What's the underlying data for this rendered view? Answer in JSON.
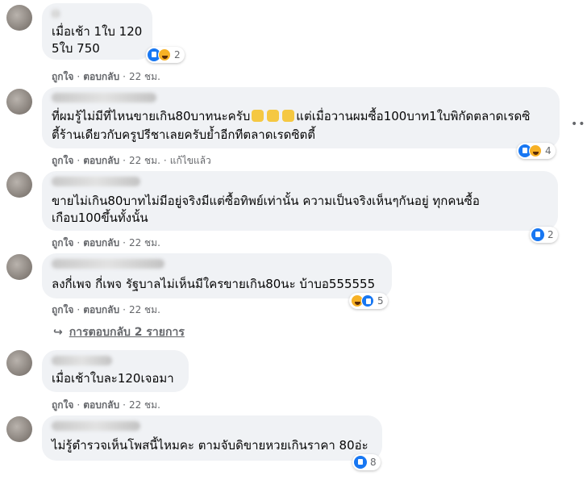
{
  "actions": {
    "like": "ถูกใจ",
    "reply": "ตอบกลับ",
    "separator": "·",
    "edited": "แก้ไขแล้ว"
  },
  "comments": [
    {
      "lines": [
        "เมื่อเช้า 1ใบ 120",
        "5ใบ 750"
      ],
      "time": "22 ชม.",
      "reaction_count": "2",
      "reactions": [
        "like-icon",
        "haha-icon"
      ]
    },
    {
      "lines": [
        "ที่ผมรู้ไม่มีที่ไหนขายเกิน80บาทนะครับ",
        "แต่เมื่อวานผมซื้อ100บาท1ใบพิกัดตลาดเรดซิ",
        "ตี้ร้านเดียวกับครูปรีชาเลยครับย้ำอีกทีตลาดเรดซิตตี้"
      ],
      "time": "22 ชม.",
      "reaction_count": "4",
      "reactions": [
        "like-icon",
        "haha-icon"
      ]
    },
    {
      "lines": [
        "ขายไม่เกิน80บาทไม่มีอยู่จริงมีแต่ซื้อทิพย์เท่านั้น ความเป็นจริงเห็นๆกันอยู่ ทุกคนซื้อ",
        "เกือบ100ขึ้นทั้งนั้น"
      ],
      "time": "22 ชม.",
      "reaction_count": "2",
      "reactions": [
        "like-icon"
      ]
    },
    {
      "lines": [
        "ลงกี่เพจ กี่เพจ รัฐบาลไม่เห็นมีใครขายเกิน80นะ บ้าบอ555555"
      ],
      "time": "22 ชม.",
      "reaction_count": "5",
      "reactions": [
        "haha-icon",
        "like-icon"
      ]
    },
    {
      "lines": [
        "เมื่อเช้าใบละ120เจอมา"
      ],
      "time": "22 ชม.",
      "reaction_count": "",
      "reactions": []
    },
    {
      "lines": [
        "ไม่รู้ตำรวจเห็นโพสนี้ไหมคะ ตามจับดิขายหวยเกินราคา 80อ่ะ"
      ],
      "time": "22 ชม.",
      "reaction_count": "8",
      "reactions": [
        "like-icon"
      ]
    }
  ],
  "replies_link": "การตอบกลับ 2 รายการ",
  "colors": {
    "bubble": "#f0f2f5",
    "meta": "#65676b",
    "like": "#1877f2",
    "haha": "#f7b125"
  }
}
